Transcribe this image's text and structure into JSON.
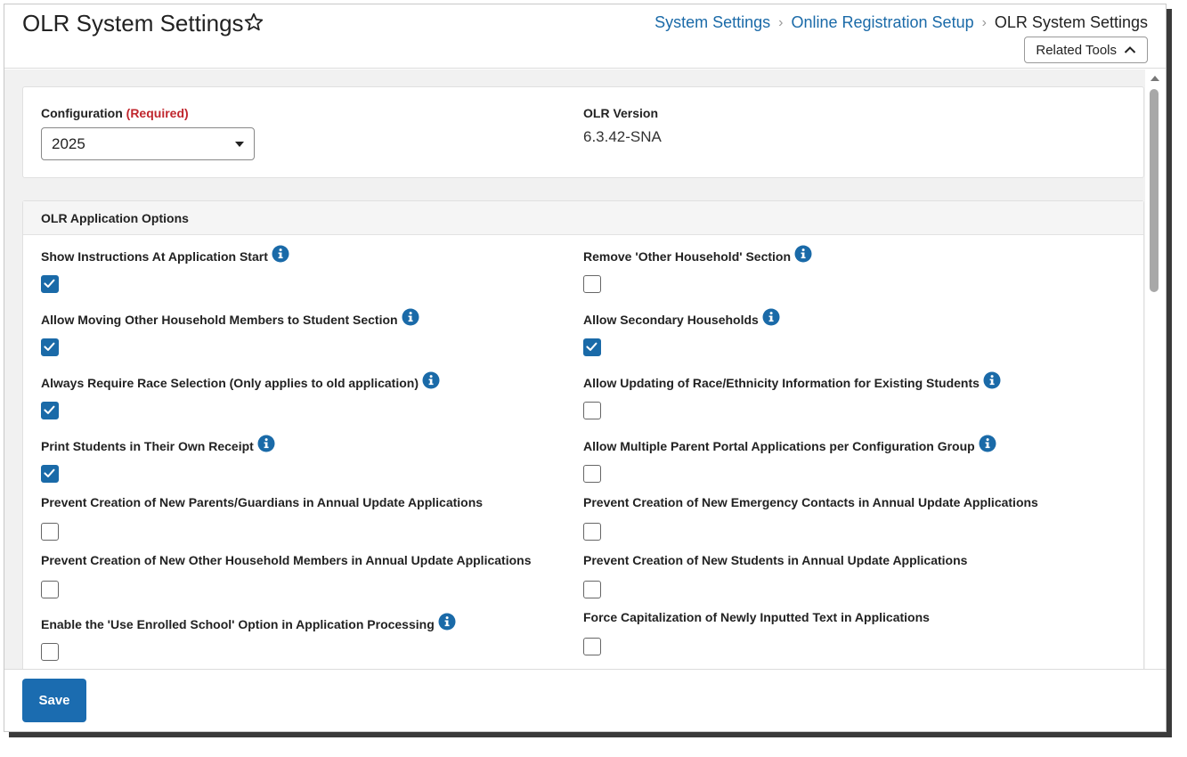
{
  "header": {
    "title": "OLR System Settings",
    "breadcrumb": [
      "System Settings",
      "Online Registration Setup",
      "OLR System Settings"
    ],
    "related_tools_label": "Related Tools"
  },
  "config": {
    "label": "Configuration",
    "required": "(Required)",
    "selected": "2025",
    "version_label": "OLR Version",
    "version_value": "6.3.42-SNA"
  },
  "options": {
    "title": "OLR Application Options",
    "items": [
      {
        "label": "Show Instructions At Application Start",
        "checked": true,
        "info": true
      },
      {
        "label": "Remove 'Other Household' Section",
        "checked": false,
        "info": true
      },
      {
        "label": "Allow Moving Other Household Members to Student Section",
        "checked": true,
        "info": true
      },
      {
        "label": "Allow Secondary Households",
        "checked": true,
        "info": true
      },
      {
        "label": "Always Require Race Selection (Only applies to old application)",
        "checked": true,
        "info": true
      },
      {
        "label": "Allow Updating of Race/Ethnicity Information for Existing Students",
        "checked": false,
        "info": true
      },
      {
        "label": "Print Students in Their Own Receipt",
        "checked": true,
        "info": true
      },
      {
        "label": "Allow Multiple Parent Portal Applications per Configuration Group",
        "checked": false,
        "info": true
      },
      {
        "label": "Prevent Creation of New Parents/Guardians in Annual Update Applications",
        "checked": false,
        "info": false
      },
      {
        "label": "Prevent Creation of New Emergency Contacts in Annual Update Applications",
        "checked": false,
        "info": false
      },
      {
        "label": "Prevent Creation of New Other Household Members in Annual Update Applications",
        "checked": false,
        "info": false
      },
      {
        "label": "Prevent Creation of New Students in Annual Update Applications",
        "checked": false,
        "info": false
      },
      {
        "label": "Enable the 'Use Enrolled School' Option in Application Processing",
        "checked": false,
        "info": true
      },
      {
        "label": "Force Capitalization of Newly Inputted Text in Applications",
        "checked": false,
        "info": false
      }
    ]
  },
  "footer": {
    "save_label": "Save"
  },
  "colors": {
    "accent": "#1a6aa8",
    "required": "#c0262d"
  }
}
